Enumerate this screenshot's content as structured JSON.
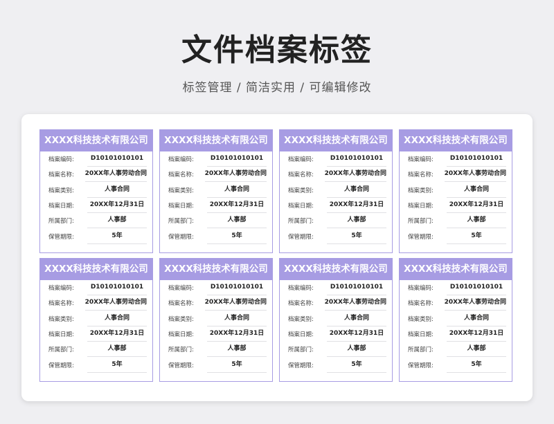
{
  "header": {
    "title": "文件档案标签",
    "subtitle": "标签管理 / 简洁实用 / 可编辑修改"
  },
  "colors": {
    "accent": "#a79ce3",
    "background": "#efeff2"
  },
  "card": {
    "company": "XXXX科技技术有限公司",
    "fields": [
      {
        "label": "档案编码:",
        "value": "D10101010101"
      },
      {
        "label": "档案名称:",
        "value": "20XX年人事劳动合同"
      },
      {
        "label": "档案类别:",
        "value": "人事合同"
      },
      {
        "label": "档案日期:",
        "value": "20XX年12月31日"
      },
      {
        "label": "所属部门:",
        "value": "人事部"
      },
      {
        "label": "保管期限:",
        "value": "5年"
      }
    ]
  },
  "card_count": 8
}
